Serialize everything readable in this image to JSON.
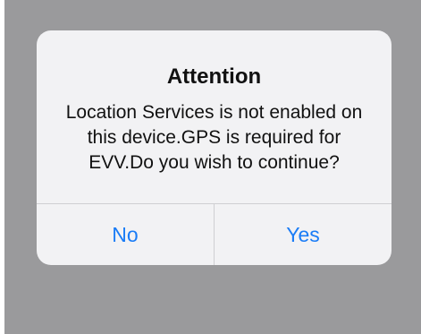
{
  "alert": {
    "title": "Attention",
    "message": "Location Services is not enabled on this device.GPS is required for EVV.Do you wish to continue?",
    "buttons": {
      "no": "No",
      "yes": "Yes"
    }
  },
  "colors": {
    "backdrop": "#9a9a9c",
    "alert_background": "#f2f2f4",
    "button_text": "#1a7cf6"
  }
}
